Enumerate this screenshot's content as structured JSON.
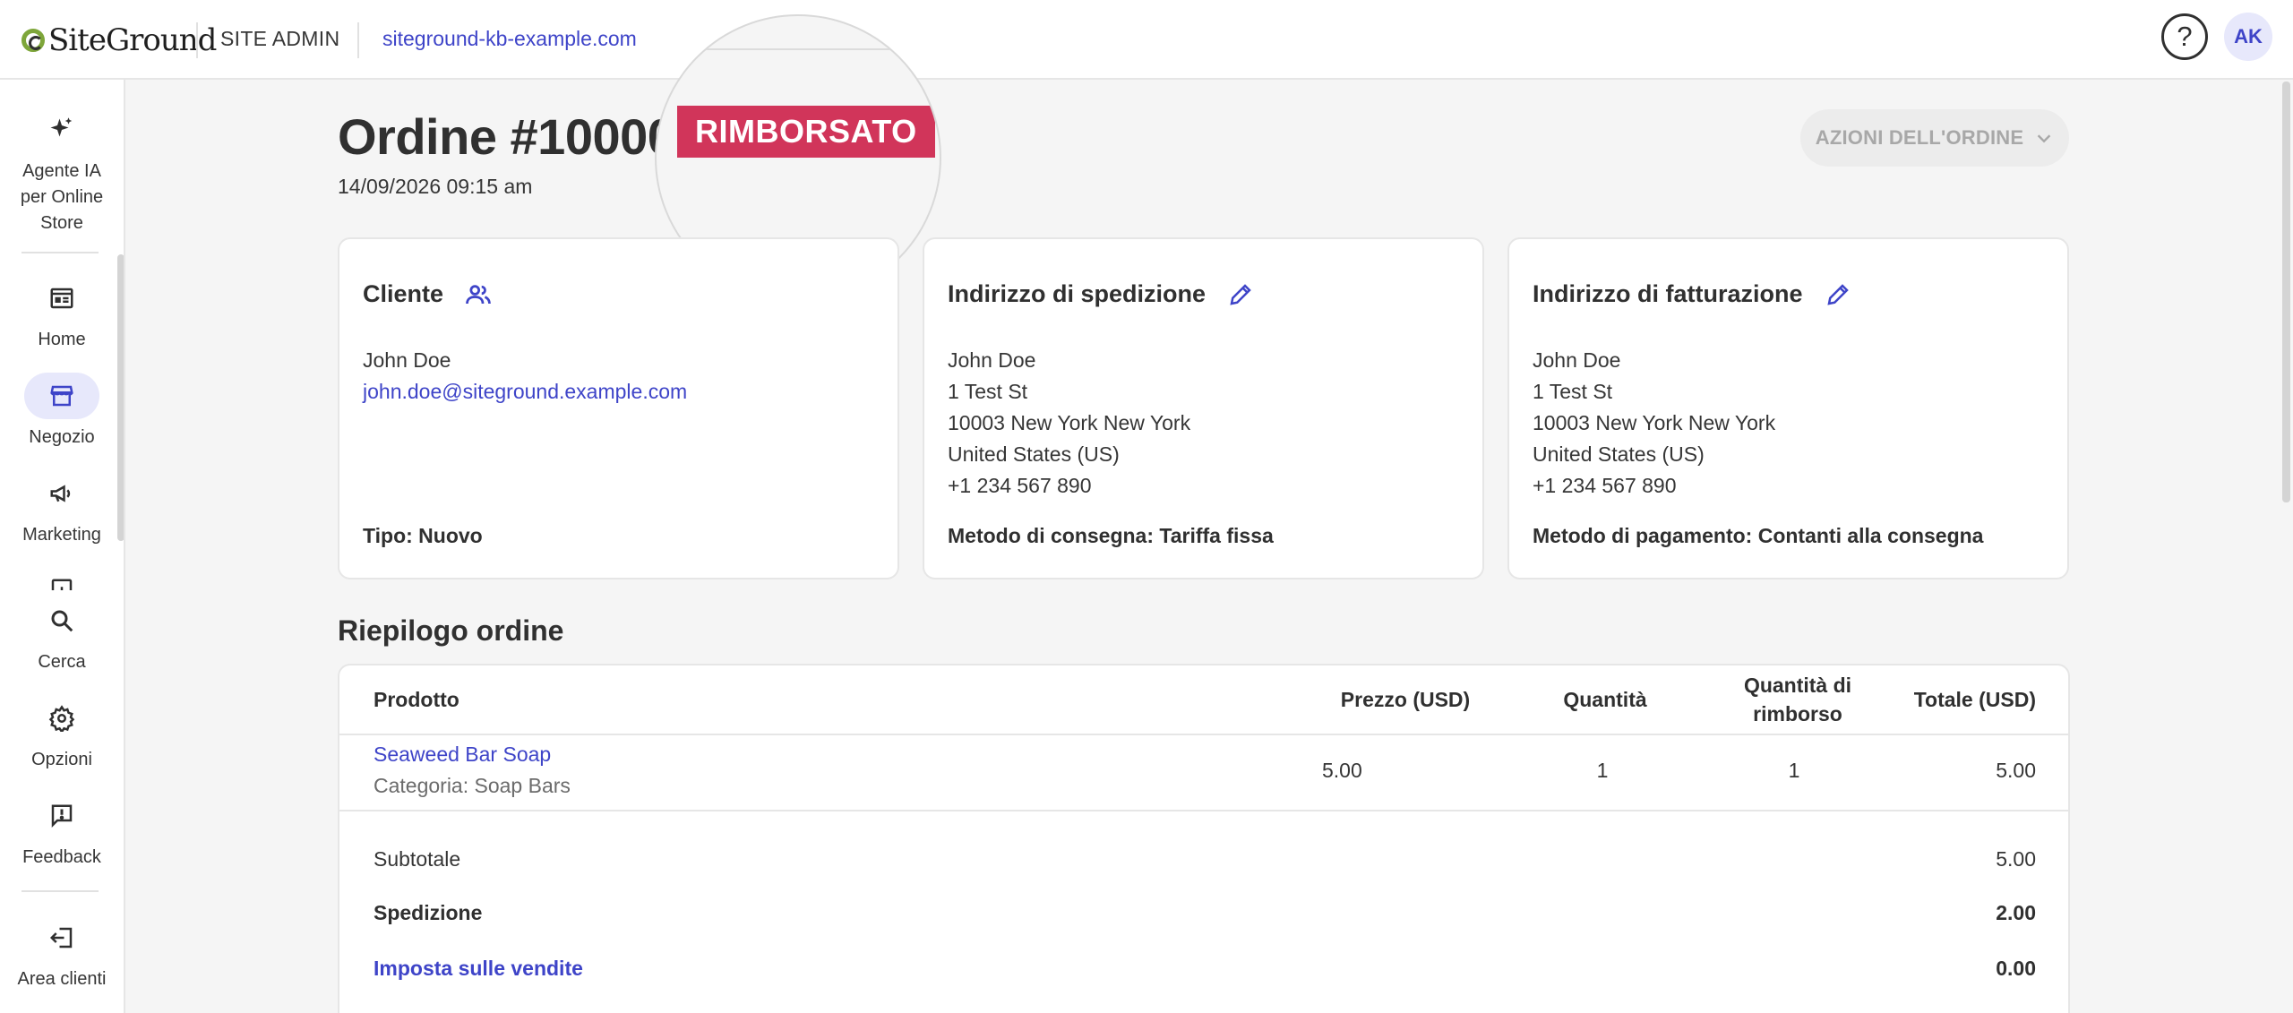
{
  "topbar": {
    "logo_text": "SiteGround",
    "site_admin": "SITE ADMIN",
    "domain": "siteground-kb-example.com",
    "help_icon": "question-mark-circle-icon",
    "avatar_initials": "AK"
  },
  "sidebar": {
    "items": [
      {
        "label_lines": [
          "Agente IA",
          "per Online",
          "Store"
        ],
        "icon": "sparkle-icon"
      },
      {
        "label": "Home",
        "icon": "browser-window-icon"
      },
      {
        "label": "Negozio",
        "icon": "storefront-icon",
        "active": true
      },
      {
        "label": "Marketing",
        "icon": "megaphone-icon"
      },
      {
        "label": "Cerca",
        "icon": "search-icon"
      },
      {
        "label": "Opzioni",
        "icon": "gear-icon"
      },
      {
        "label": "Feedback",
        "icon": "feedback-message-icon"
      },
      {
        "label": "Area clienti",
        "icon": "exit-icon"
      }
    ]
  },
  "order": {
    "title": "Ordine #10000",
    "status": "RIMBORSATO",
    "date": "14/09/2026 09:15 am",
    "actions_label": "AZIONI DELL'ORDINE"
  },
  "customer_card": {
    "title": "Cliente",
    "name": "John Doe",
    "email": "john.doe@siteground.example.com",
    "type": "Tipo: Nuovo"
  },
  "shipping_card": {
    "title": "Indirizzo di spedizione",
    "lines": [
      "John Doe",
      "1 Test St",
      "10003 New York New York",
      "United States (US)",
      "+1 234 567 890"
    ],
    "method": "Metodo di consegna: Tariffa fissa"
  },
  "billing_card": {
    "title": "Indirizzo di fatturazione",
    "lines": [
      "John Doe",
      "1 Test St",
      "10003 New York New York",
      "United States (US)",
      "+1 234 567 890"
    ],
    "method": "Metodo di pagamento: Contanti alla consegna"
  },
  "summary": {
    "title": "Riepilogo ordine",
    "headers": {
      "product": "Prodotto",
      "price": "Prezzo (USD)",
      "quantity": "Quantità",
      "refund_qty_1": "Quantità di",
      "refund_qty_2": "rimborso",
      "total": "Totale (USD)"
    },
    "rows": [
      {
        "product": "Seaweed Bar Soap",
        "category": "Categoria: Soap Bars",
        "price": "5.00",
        "quantity": "1",
        "refund_qty": "1",
        "total": "5.00"
      }
    ],
    "totals": {
      "subtotal_label": "Subtotale",
      "subtotal": "5.00",
      "shipping_label": "Spedizione",
      "shipping": "2.00",
      "tax_label": "Imposta sulle vendite",
      "tax": "0.00"
    }
  }
}
